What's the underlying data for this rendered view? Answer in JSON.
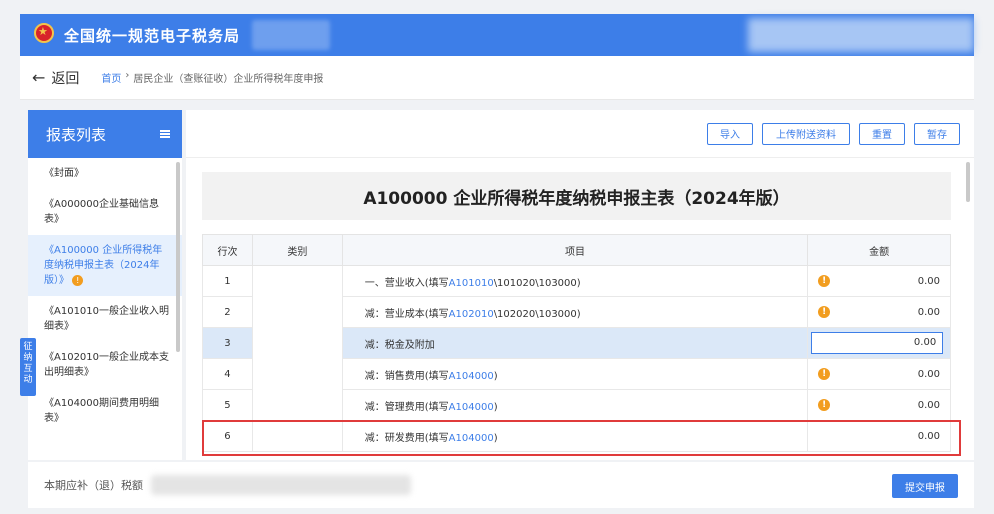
{
  "header": {
    "app_title": "全国统一规范电子税务局",
    "logo": "tax-emblem-icon"
  },
  "nav": {
    "back_label": "返回",
    "breadcrumb": [
      "首页",
      "居民企业（查账征收）企业所得税年度申报"
    ],
    "breadcrumb_separator": "›"
  },
  "sidebar": {
    "title": "报表列表",
    "items": [
      {
        "label": "《封面》"
      },
      {
        "label": "《A000000企业基础信息表》"
      },
      {
        "label": "《A100000 企业所得税年度纳税申报主表（2024年版）》",
        "active": true,
        "badge": "!"
      },
      {
        "label": "《A101010一般企业收入明细表》"
      },
      {
        "label": "《A102010一般企业成本支出明细表》"
      },
      {
        "label": "《A104000期间费用明细表》"
      }
    ]
  },
  "float_tab": {
    "label": "征纳互动"
  },
  "toolbar": {
    "import_label": "导入",
    "upload_label": "上传附送资料",
    "reset_label": "重置",
    "save_label": "暂存"
  },
  "form": {
    "title": "A100000 企业所得税年度纳税申报主表（2024年版）",
    "columns": [
      "行次",
      "类别",
      "项目",
      "金额"
    ],
    "rows": [
      {
        "idx": "1",
        "prefix": "一、营业收入(填写",
        "link": "A101010",
        "suffix": "\\101020\\103000)",
        "amount": "0.00",
        "warn": true
      },
      {
        "idx": "2",
        "prefix": "减：营业成本(填写",
        "link": "A102010",
        "suffix": "\\102020\\103000)",
        "amount": "0.00",
        "warn": true
      },
      {
        "idx": "3",
        "prefix": "减：税金及附加",
        "link": "",
        "suffix": "",
        "amount": "0.00",
        "warn": false,
        "editable": true
      },
      {
        "idx": "4",
        "prefix": "减：销售费用(填写",
        "link": "A104000",
        "suffix": ")",
        "amount": "0.00",
        "warn": true
      },
      {
        "idx": "5",
        "prefix": "减：管理费用(填写",
        "link": "A104000",
        "suffix": ")",
        "amount": "0.00",
        "warn": true
      },
      {
        "idx": "6",
        "prefix": "减：研发费用(填写",
        "link": "A104000",
        "suffix": ")",
        "amount": "0.00",
        "warn": false
      }
    ]
  },
  "footer": {
    "label": "本期应补（退）税额",
    "submit_label": "提交申报"
  },
  "colors": {
    "brand": "#3d7ee8",
    "warning": "#f29d1f",
    "highlight": "#e03b3b"
  }
}
